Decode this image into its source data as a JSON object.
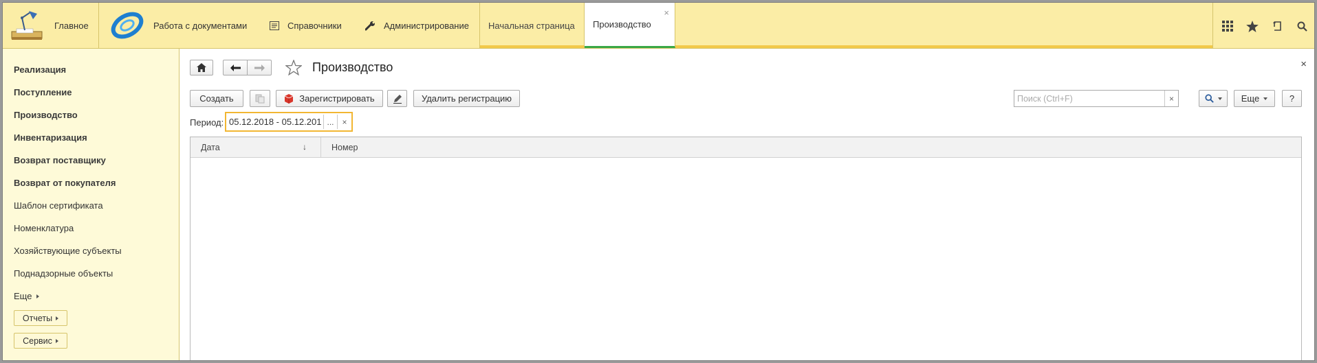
{
  "topbar": {
    "home_label": "Главное",
    "sections": [
      {
        "label": "Работа с документами",
        "icon": "documents-logo-icon"
      },
      {
        "label": "Справочники",
        "icon": "list-icon"
      },
      {
        "label": "Администрирование",
        "icon": "wrench-icon"
      }
    ],
    "tabs": [
      {
        "label": "Начальная страница"
      },
      {
        "label": "Производство",
        "active": true
      }
    ],
    "tab_close": "×",
    "tools": [
      "apps-grid-icon",
      "star-icon",
      "history-icon",
      "search-icon"
    ]
  },
  "sidebar": {
    "items": [
      {
        "label": "Реализация",
        "bold": true
      },
      {
        "label": "Поступление",
        "bold": true
      },
      {
        "label": "Производство",
        "bold": true
      },
      {
        "label": "Инвентаризация",
        "bold": true
      },
      {
        "label": "Возврат поставщику",
        "bold": true
      },
      {
        "label": "Возврат от покупателя",
        "bold": true
      },
      {
        "label": "Шаблон сертификата",
        "bold": false
      },
      {
        "label": "Номенклатура",
        "bold": false
      },
      {
        "label": "Хозяйствующие субъекты",
        "bold": false
      },
      {
        "label": "Поднадзорные объекты",
        "bold": false
      }
    ],
    "more_label": "Еще",
    "reports_label": "Отчеты",
    "service_label": "Сервис"
  },
  "form": {
    "title": "Производство",
    "close": "×",
    "toolbar": {
      "create_label": "Создать",
      "register_label": "Зарегистрировать",
      "delete_registration_label": "Удалить регистрацию",
      "more_label": "Еще",
      "help_label": "?"
    },
    "search": {
      "placeholder": "Поиск (Ctrl+F)",
      "clear": "×"
    },
    "period": {
      "label": "Период:",
      "value": "05.12.2018 - 05.12.201",
      "select": "...",
      "clear": "×"
    },
    "table": {
      "columns": [
        "Дата",
        "Номер"
      ],
      "sort_indicator": "↓",
      "rows": []
    }
  },
  "colors": {
    "topbar_bg": "#fbeda6",
    "sidebar_bg": "#fefad8",
    "accent_yellow": "#f2b632",
    "active_tab_green": "#3aa846"
  }
}
